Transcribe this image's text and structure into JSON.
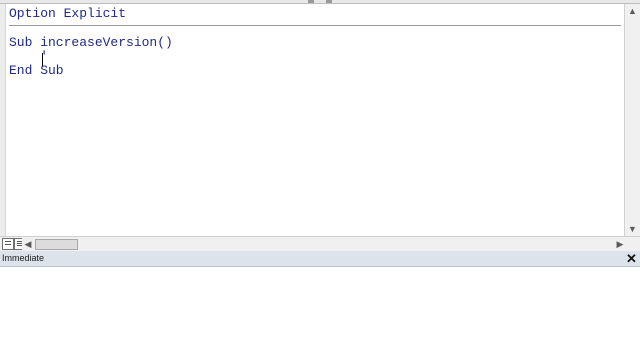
{
  "code_window": {
    "lines": [
      "Option Explicit",
      "Sub increaseVersion()",
      "    '",
      "End Sub"
    ],
    "text_color": "#1f2a86"
  },
  "immediate_window": {
    "title": "Immediate",
    "close_glyph": "✕"
  },
  "scrollbars": {
    "up_arrow": "▲",
    "down_arrow": "▼",
    "left_arrow": "◀",
    "right_arrow": "▶"
  }
}
